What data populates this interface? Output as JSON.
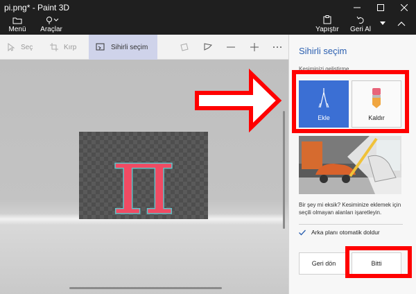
{
  "window": {
    "title": "pi.png* - Paint 3D"
  },
  "ribbon": {
    "menu_label": "Menü",
    "tools_label": "Araçlar",
    "paste_label": "Yapıştır",
    "undo_label": "Geri Al"
  },
  "toolbar": {
    "select_label": "Seç",
    "crop_label": "Kırp",
    "magic_select_label": "Sihirli seçim"
  },
  "panel": {
    "title": "Sihirli seçim",
    "subtitle": "Kesiminizi geliştirme",
    "add_label": "Ekle",
    "remove_label": "Kaldır",
    "help_text": "Bir şey mi eksik? Kesiminize eklemek için seçili olmayan alanları işaretleyin.",
    "autofill_label": "Arka planı otomatik doldur",
    "autofill_checked": true,
    "back_label": "Geri dön",
    "done_label": "Bitti"
  },
  "canvas": {
    "glyph": "π"
  },
  "colors": {
    "accent": "#3b6fd4",
    "annotation": "#ff0000",
    "glyph": "#f04b63"
  }
}
